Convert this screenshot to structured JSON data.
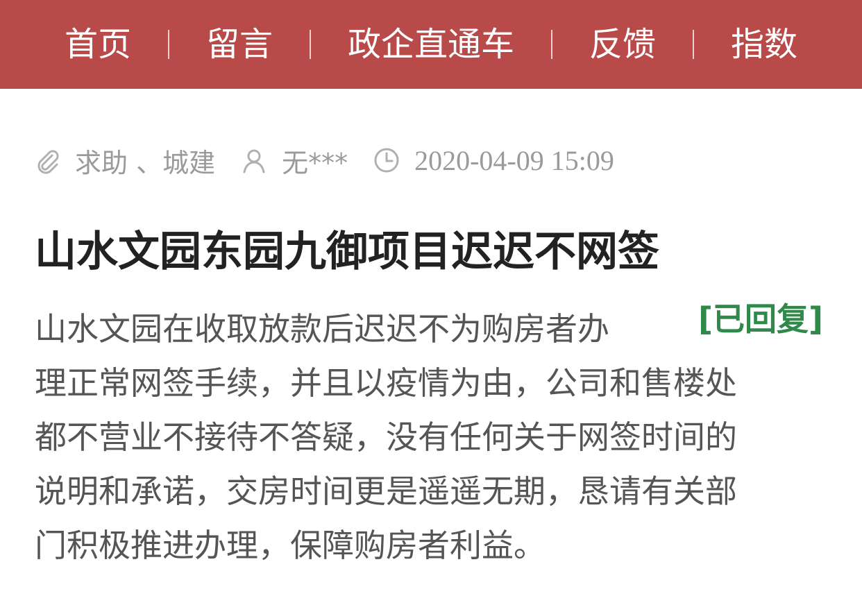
{
  "nav": {
    "items": [
      {
        "label": "首页"
      },
      {
        "label": "留言"
      },
      {
        "label": "政企直通车"
      },
      {
        "label": "反馈"
      },
      {
        "label": "指数"
      }
    ]
  },
  "meta": {
    "category": "求助 、城建",
    "author": "无***",
    "datetime": "2020-04-09 15:09"
  },
  "post": {
    "title": "山水文园东园九御项目迟迟不网签",
    "status": "[已回复]",
    "body_lines": [
      "山水文园在收取放款后迟迟不为购房者办",
      "理正常网签手续，并且以疫情为由，公司和售楼处",
      "都不营业不接待不答疑，没有任何关于网签时间的",
      "说明和承诺，交房时间更是遥遥无期，恳请有关部",
      "门积极推进办理，保障购房者利益。"
    ]
  },
  "colors": {
    "nav_bg": "#b94a4a",
    "status_green": "#2f8a4a",
    "meta_gray": "#9a9a9a"
  }
}
